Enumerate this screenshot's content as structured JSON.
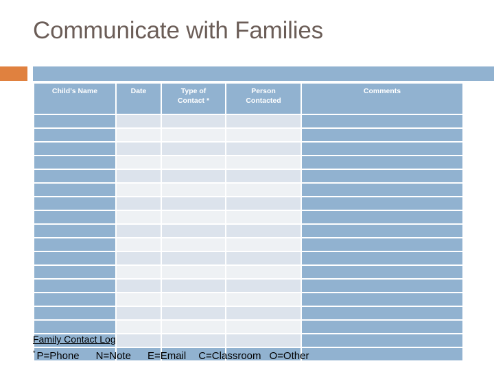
{
  "slide": {
    "title": "Communicate with Families",
    "title_color": "#6b5d57"
  },
  "accent": {
    "orange_color": "#e0813f",
    "blue_color": "#91b2d0"
  },
  "table": {
    "headers": [
      "Child’s Name",
      "Date",
      "Type of\nContact *",
      "Person\nContacted",
      "Comments"
    ],
    "header_line1": [
      "Child’s Name",
      "Date",
      "Type of",
      "Person",
      "Comments"
    ],
    "header_line2": [
      "",
      "",
      "Contact *",
      "Contacted",
      ""
    ],
    "body_row_count": 17,
    "body_rows_are_empty": true,
    "colors": {
      "header_fill": "#91b2d0",
      "header_text": "#ffffff",
      "edge_column_fill": "#91b2d0",
      "middle_fill_a": "#dce3ec",
      "middle_fill_b": "#eef1f4",
      "grid_gap": "#ffffff"
    }
  },
  "footer": {
    "title": "Family Contact Log",
    "legend_marker": "*",
    "legend_items": [
      "P=Phone",
      "N=Note",
      "E=Email",
      "C=Classroom",
      "O=Other"
    ]
  }
}
